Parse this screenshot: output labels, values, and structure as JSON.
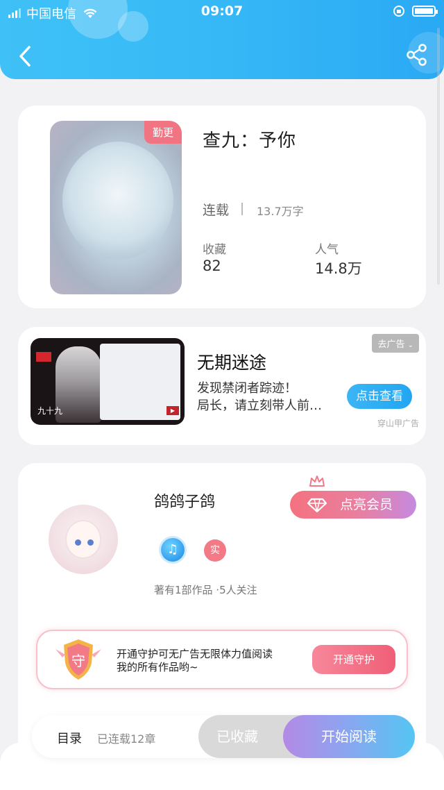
{
  "status_bar": {
    "carrier": "中国电信",
    "time": "09:07"
  },
  "book": {
    "badge": "勤更",
    "title": "查九：予你",
    "status": "连载",
    "word_count": "13.7万字",
    "favorites_label": "收藏",
    "favorites_value": "82",
    "popularity_label": "人气",
    "popularity_value": "14.8万"
  },
  "ad": {
    "close_label": "去广告",
    "title": "无期迷途",
    "desc_line1": "发现禁闭者踪迹！",
    "desc_line2": "局长，请立刻带人前…",
    "cta": "点击查看",
    "source": "穿山甲广告",
    "image_caption": "九十九"
  },
  "author": {
    "name": "鸽鸽子鸽",
    "vip_label": "点亮会员",
    "real_badge": "实",
    "info": "著有1部作品 ·5人关注",
    "guard_text_line1": "开通守护可无广告无限体力值阅读",
    "guard_text_line2": "我的所有作品哟~",
    "guard_btn": "开通守护",
    "guard_icon_char": "守"
  },
  "bottom": {
    "toc": "目录",
    "chapters": "已连载12章",
    "collected": "已收藏",
    "read": "开始阅读"
  }
}
